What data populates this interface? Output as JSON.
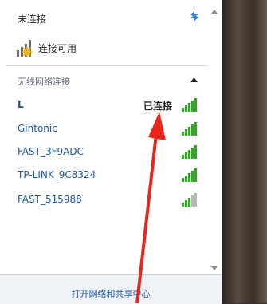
{
  "status": {
    "header": "未连接",
    "connection_label": "连接可用",
    "refresh_icon": "refresh-icon"
  },
  "section": {
    "title": "无线网络连接",
    "collapse_icon": "chevron-up-icon"
  },
  "networks": [
    {
      "name": "L",
      "status": "已连接",
      "signal": "strong",
      "connected": true
    },
    {
      "name": "Gintonic",
      "status": "",
      "signal": "strong",
      "connected": false
    },
    {
      "name": "FAST_3F9ADC",
      "status": "",
      "signal": "strong",
      "connected": false
    },
    {
      "name": "TP-LINK_9C8324",
      "status": "",
      "signal": "strong",
      "connected": false
    },
    {
      "name": "FAST_515988",
      "status": "",
      "signal": "medium",
      "connected": false
    }
  ],
  "footer": {
    "link": "打开网络和共享中心"
  },
  "colors": {
    "link_blue": "#1b55a8",
    "signal_green": "#3aa02e",
    "annotation_red": "#e8261c"
  }
}
